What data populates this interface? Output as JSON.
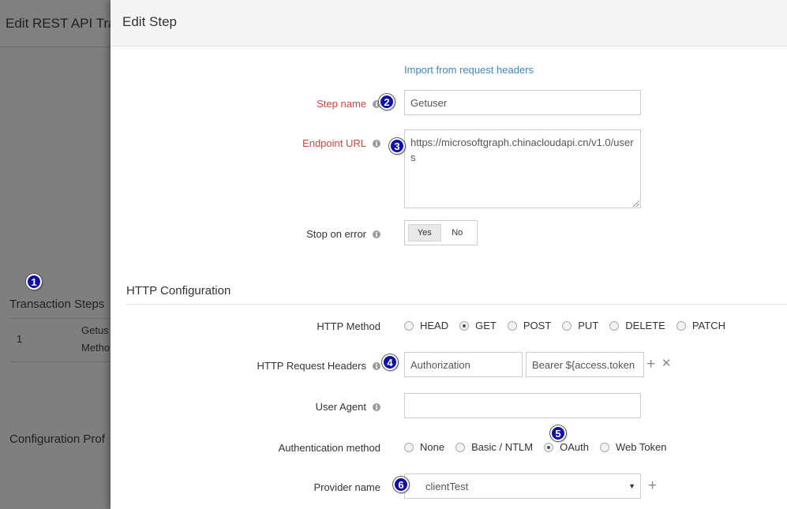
{
  "background": {
    "title": "Edit REST API Tra",
    "transaction_steps": "Transaction Steps",
    "row_number": "1",
    "row_line1": "Getus",
    "row_line2": "Metho",
    "configuration_profiles": "Configuration Prof"
  },
  "badges": [
    "1",
    "2",
    "3",
    "4",
    "5",
    "6"
  ],
  "panel": {
    "title": "Edit Step",
    "import_link": "Import from request headers",
    "step_name": {
      "label": "Step name",
      "value": "Getuser"
    },
    "endpoint_url": {
      "label": "Endpoint URL",
      "value": "https://microsoftgraph.chinacloudapi.cn/v1.0/users"
    },
    "stop_on_error": {
      "label": "Stop on error",
      "yes": "Yes",
      "no": "No",
      "selected": "Yes"
    },
    "http_section_title": "HTTP Configuration",
    "http_method": {
      "label": "HTTP Method",
      "options": [
        "HEAD",
        "GET",
        "POST",
        "PUT",
        "DELETE",
        "PATCH"
      ],
      "selected": "GET"
    },
    "http_request_headers": {
      "label": "HTTP Request Headers",
      "header_name": "Authorization",
      "header_value": "Bearer ${access.token"
    },
    "user_agent": {
      "label": "User Agent",
      "value": ""
    },
    "authentication_method": {
      "label": "Authentication method",
      "options": [
        "None",
        "Basic / NTLM",
        "OAuth",
        "Web Token"
      ],
      "selected": "OAuth"
    },
    "provider_name": {
      "label": "Provider name",
      "value": "clientTest"
    }
  },
  "icons": {
    "info": "i",
    "plus": "+",
    "close": "✕",
    "caret": "▼"
  }
}
